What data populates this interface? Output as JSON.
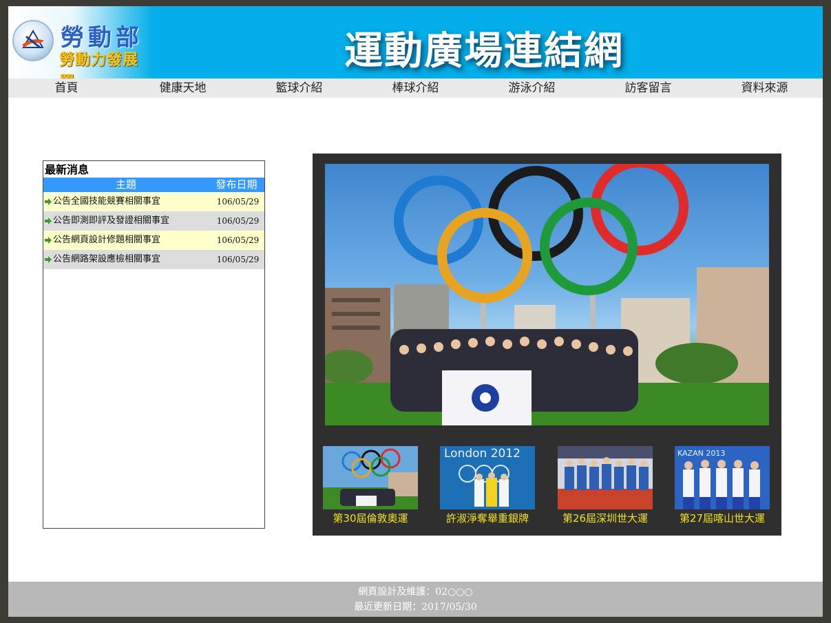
{
  "header": {
    "logo_line1": "勞動部",
    "logo_line2": "勞動力發展署",
    "site_title": "運動廣場連結網"
  },
  "nav": {
    "items": [
      "首頁",
      "健康天地",
      "籃球介紹",
      "棒球介紹",
      "游泳介紹",
      "訪客留言",
      "資料來源"
    ]
  },
  "news": {
    "title": "最新消息",
    "col_subject": "主題",
    "col_date": "發布日期",
    "rows": [
      {
        "subject": "公告全國技能競賽相關事宜",
        "date": "106/05/29"
      },
      {
        "subject": "公告即測即評及發證相關事宜",
        "date": "106/05/29"
      },
      {
        "subject": "公告網頁設計修題相關事宜",
        "date": "106/05/29"
      },
      {
        "subject": "公告網路架設應檢相關事宜",
        "date": "106/05/29"
      }
    ]
  },
  "gallery": {
    "thumbs": [
      {
        "caption": "第30屆倫敦奧運"
      },
      {
        "caption": "許淑淨奪舉重銀牌",
        "overlay": "London 2012"
      },
      {
        "caption": "第26屆深圳世大運"
      },
      {
        "caption": "第27屆喀山世大運",
        "overlay": "KAZAN 2013"
      }
    ]
  },
  "footer": {
    "line1": "網頁設計及維護：02○○○",
    "line2": "最近更新日期：2017/05/30"
  },
  "colors": {
    "header_bg": "#04aee8",
    "nav_bg": "#e9e9e9",
    "news_header_bg": "#3399ff",
    "news_row_odd": "#ffffcc",
    "news_row_even": "#dddddd",
    "caption_color": "#f2e21b",
    "footer_bg": "#b8b8b8"
  }
}
